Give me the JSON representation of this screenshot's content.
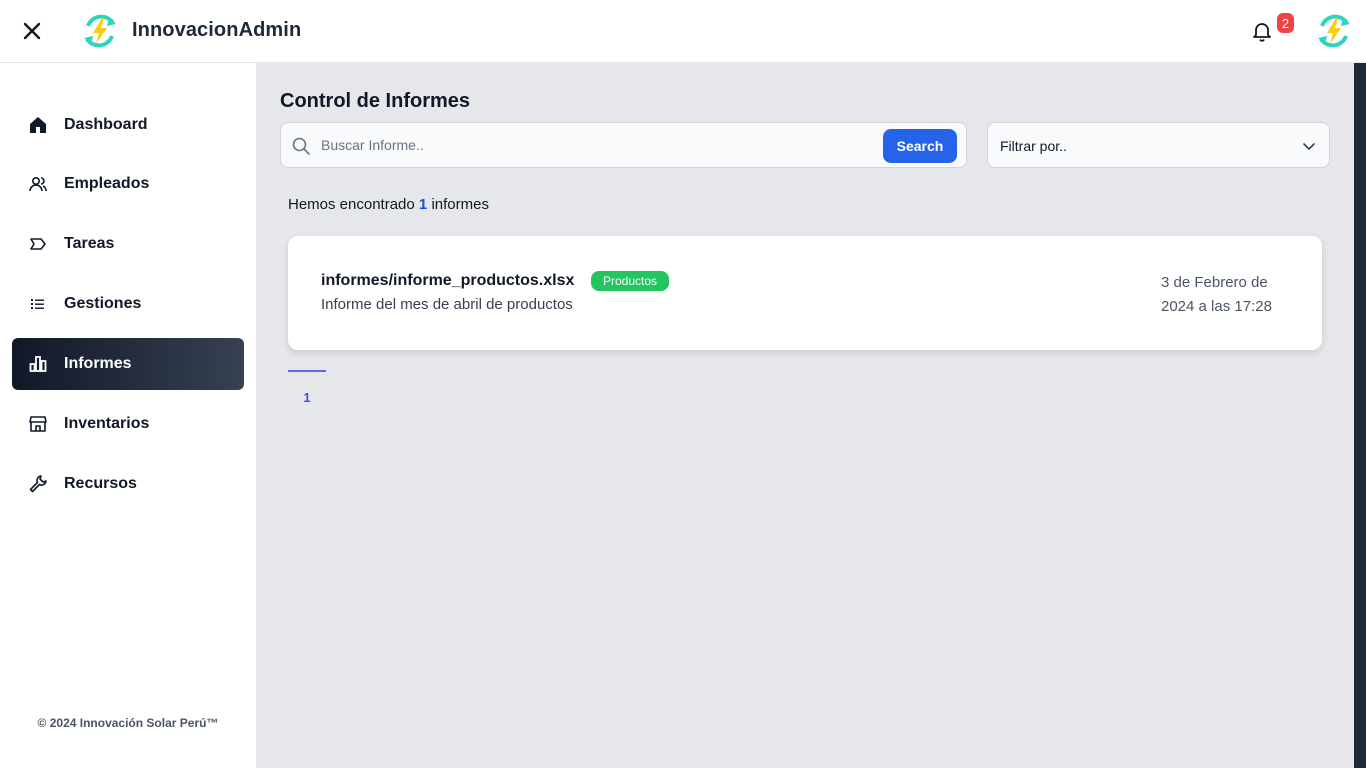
{
  "header": {
    "brand": "InnovacionAdmin",
    "notification_count": "2"
  },
  "sidebar": {
    "items": [
      {
        "label": "Dashboard",
        "icon": "home-icon"
      },
      {
        "label": "Empleados",
        "icon": "users-icon"
      },
      {
        "label": "Tareas",
        "icon": "tag-icon"
      },
      {
        "label": "Gestiones",
        "icon": "list-icon"
      },
      {
        "label": "Informes",
        "icon": "bar-chart-icon",
        "active": true
      },
      {
        "label": "Inventarios",
        "icon": "store-icon"
      },
      {
        "label": "Recursos",
        "icon": "wrench-icon"
      }
    ],
    "footer": "© 2024 Innovación Solar Perú™"
  },
  "main": {
    "title": "Control de Informes",
    "search": {
      "placeholder": "Buscar Informe..",
      "button_label": "Search"
    },
    "filter": {
      "label": "Filtrar por.."
    },
    "results": {
      "prefix": "Hemos encontrado",
      "count": "1",
      "suffix": "informes"
    },
    "reports": [
      {
        "file": "informes/informe_productos.xlsx",
        "tag": "Productos",
        "description": "Informe del mes de abril de productos",
        "date": "3 de Febrero de 2024 a las 17:28"
      }
    ],
    "pagination": {
      "current": "1"
    }
  },
  "colors": {
    "accent": "#2563eb",
    "tag_green": "#22c55e",
    "badge_red": "#ef4444",
    "active_nav": "#111827",
    "main_bg": "#e5e7eb"
  }
}
